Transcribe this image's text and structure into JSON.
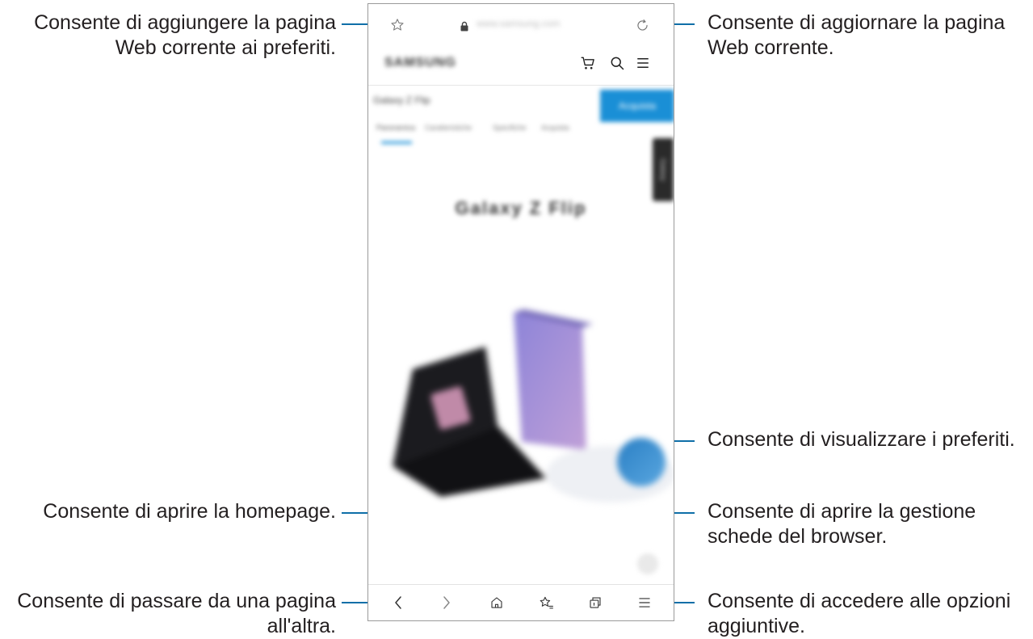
{
  "browser": {
    "address_url": "www.samsung.com",
    "site_logo": "SAMSUNG",
    "promo_text": "Galaxy Z Flip",
    "promo_button": "Acquista",
    "sub_tabs": [
      "Panoramica",
      "Caratteristiche",
      "Specifiche",
      "Acquista"
    ],
    "side_tab": "Galaxy",
    "hero_title": "Galaxy Z Flip"
  },
  "callouts": {
    "add_bookmark": [
      "Consente di aggiungere la pagina",
      "Web corrente ai preferiti."
    ],
    "refresh": [
      "Consente di aggiornare la pagina",
      "Web corrente."
    ],
    "view_bookmarks": [
      "Consente di visualizzare i preferiti."
    ],
    "home": [
      "Consente di aprire la homepage."
    ],
    "tabs_manager": [
      "Consente di aprire la gestione",
      "schede del browser."
    ],
    "navigate": [
      "Consente di passare da una pagina",
      "all'altra."
    ],
    "options": [
      "Consente di accedere alle opzioni",
      "aggiuntive."
    ]
  },
  "colors": {
    "callout_line": "#0f6fa8",
    "promo_button": "#1a8fd6"
  }
}
